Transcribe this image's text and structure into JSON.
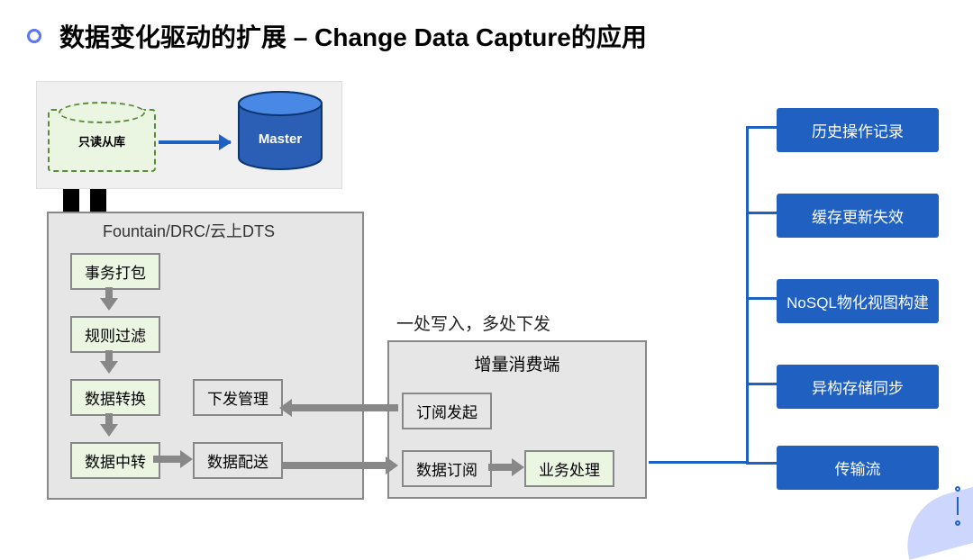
{
  "title": "数据变化驱动的扩展 – Change Data Capture的应用",
  "db_panel": {
    "replica_label": "只读从库",
    "master_label": "Master"
  },
  "main_panel": {
    "title": "Fountain/DRC/云上DTS",
    "steps": {
      "pack": "事务打包",
      "filter": "规则过滤",
      "transform": "数据转换",
      "relay": "数据中转",
      "deliver": "数据配送",
      "delivery_mgmt": "下发管理"
    }
  },
  "note": "一处写入，多处下发",
  "consumer_panel": {
    "title": "增量消费端",
    "subscribe_init": "订阅发起",
    "data_subscribe": "数据订阅",
    "biz_process": "业务处理"
  },
  "right_targets": {
    "history": "历史操作记录",
    "cache": "缓存更新失效",
    "nosql": "NoSQL物化视图构建",
    "hetero": "异构存储同步",
    "stream": "传输流"
  }
}
